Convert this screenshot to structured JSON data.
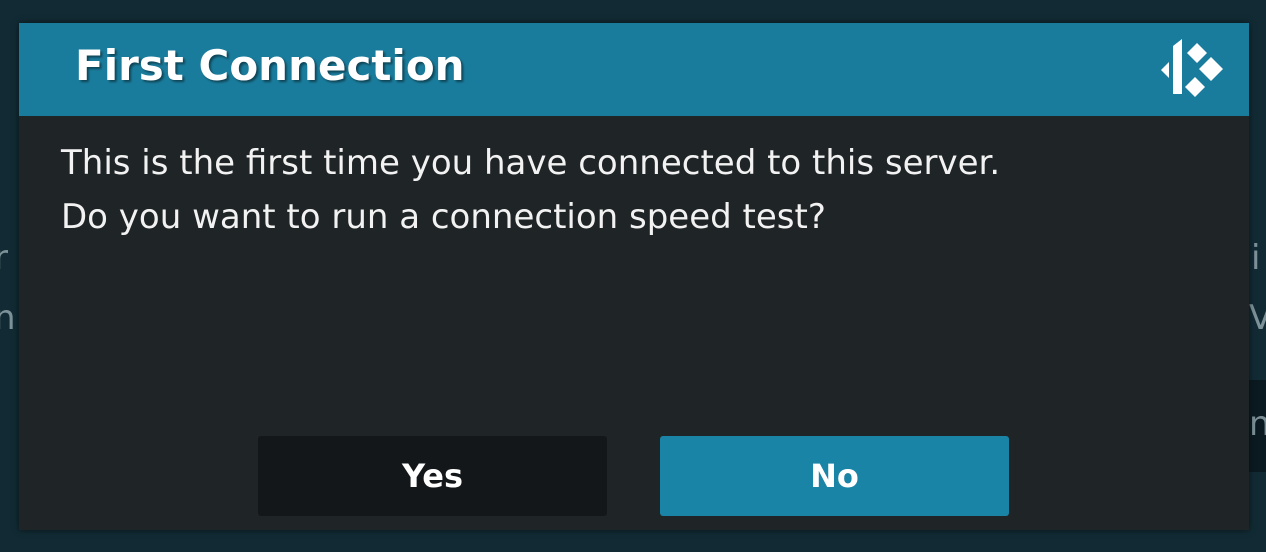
{
  "background": {
    "left_fragments": [
      "r",
      "n"
    ],
    "right_fragments": [
      "i",
      "V",
      "n"
    ]
  },
  "dialog": {
    "title": "First Connection",
    "logo_icon": "kodi-logo-icon",
    "message_lines": [
      "This is the first time you have connected to this server.",
      "Do you want to run a connection speed test?"
    ],
    "buttons": {
      "yes_label": "Yes",
      "no_label": "No"
    },
    "colors": {
      "header": "#1a7c9c",
      "body": "#1f2427",
      "focused_button": "#1a84a6",
      "button": "#141719"
    }
  }
}
